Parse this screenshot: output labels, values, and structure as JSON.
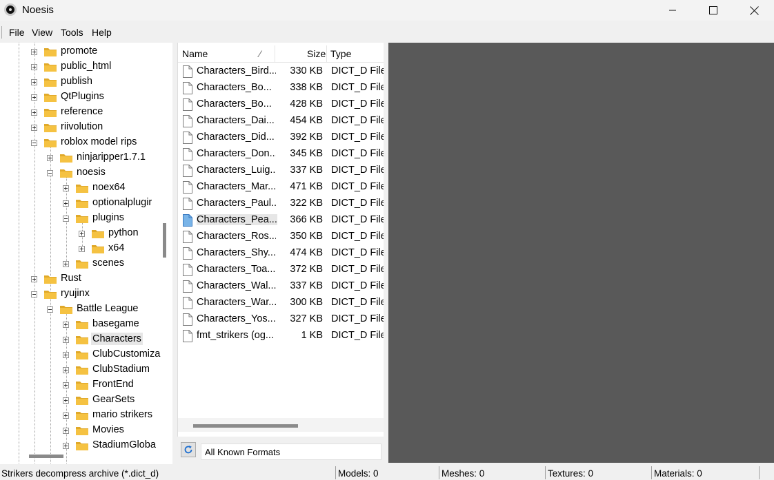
{
  "window": {
    "title": "Noesis"
  },
  "menu": [
    "File",
    "View",
    "Tools",
    "Help"
  ],
  "tree": [
    {
      "label": "promote",
      "expanded": false
    },
    {
      "label": "public_html",
      "expanded": false
    },
    {
      "label": "publish",
      "expanded": false
    },
    {
      "label": "QtPlugins",
      "expanded": false
    },
    {
      "label": "reference",
      "expanded": false
    },
    {
      "label": "riivolution",
      "expanded": false
    },
    {
      "label": "roblox model rips",
      "expanded": true
    },
    {
      "label": "ninjaripper1.7.1",
      "expanded": false
    },
    {
      "label": "noesis",
      "expanded": true
    },
    {
      "label": "noex64",
      "expanded": false
    },
    {
      "label": "optionalplugir",
      "expanded": false
    },
    {
      "label": "plugins",
      "expanded": true
    },
    {
      "label": "python",
      "expanded": false
    },
    {
      "label": "x64",
      "expanded": false
    },
    {
      "label": "scenes",
      "expanded": false
    },
    {
      "label": "Rust",
      "expanded": false
    },
    {
      "label": "ryujinx",
      "expanded": true
    },
    {
      "label": "Battle League",
      "expanded": true
    },
    {
      "label": "basegame",
      "expanded": false
    },
    {
      "label": "Characters",
      "expanded": false,
      "selected": true
    },
    {
      "label": "ClubCustomiza",
      "expanded": false
    },
    {
      "label": "ClubStadium",
      "expanded": false
    },
    {
      "label": "FrontEnd",
      "expanded": false
    },
    {
      "label": "GearSets",
      "expanded": false
    },
    {
      "label": "mario strikers",
      "expanded": false
    },
    {
      "label": "Movies",
      "expanded": false
    },
    {
      "label": "StadiumGloba",
      "expanded": false
    }
  ],
  "filelist": {
    "columns": {
      "name": "Name",
      "size": "Size",
      "type": "Type"
    },
    "sort_indicator": "⁄",
    "files": [
      {
        "name": "Characters_Bird...",
        "size": "330 KB",
        "type": "DICT_D File"
      },
      {
        "name": "Characters_Bo...",
        "size": "338 KB",
        "type": "DICT_D File"
      },
      {
        "name": "Characters_Bo...",
        "size": "428 KB",
        "type": "DICT_D File"
      },
      {
        "name": "Characters_Dai...",
        "size": "454 KB",
        "type": "DICT_D File"
      },
      {
        "name": "Characters_Did...",
        "size": "392 KB",
        "type": "DICT_D File"
      },
      {
        "name": "Characters_Don...",
        "size": "345 KB",
        "type": "DICT_D File"
      },
      {
        "name": "Characters_Luig...",
        "size": "337 KB",
        "type": "DICT_D File"
      },
      {
        "name": "Characters_Mar...",
        "size": "471 KB",
        "type": "DICT_D File"
      },
      {
        "name": "Characters_Paul...",
        "size": "322 KB",
        "type": "DICT_D File"
      },
      {
        "name": "Characters_Pea...",
        "size": "366 KB",
        "type": "DICT_D File",
        "selected": true
      },
      {
        "name": "Characters_Ros...",
        "size": "350 KB",
        "type": "DICT_D File"
      },
      {
        "name": "Characters_Shy...",
        "size": "474 KB",
        "type": "DICT_D File"
      },
      {
        "name": "Characters_Toa...",
        "size": "372 KB",
        "type": "DICT_D File"
      },
      {
        "name": "Characters_Wal...",
        "size": "337 KB",
        "type": "DICT_D File"
      },
      {
        "name": "Characters_War...",
        "size": "300 KB",
        "type": "DICT_D File"
      },
      {
        "name": "Characters_Yos...",
        "size": "327 KB",
        "type": "DICT_D File"
      },
      {
        "name": "fmt_strikers (og...",
        "size": "1 KB",
        "type": "DICT_D File"
      }
    ]
  },
  "format_filter": "All Known Formats",
  "status": {
    "message": "Strikers decompress archive (*.dict_d)",
    "models": "Models: 0",
    "meshes": "Meshes: 0",
    "textures": "Textures: 0",
    "materials": "Materials: 0"
  },
  "colors": {
    "folder": "#f5c242",
    "folder_dark": "#e0a92a",
    "preview_bg": "#595959",
    "selection_icon": "#79b4e8"
  }
}
